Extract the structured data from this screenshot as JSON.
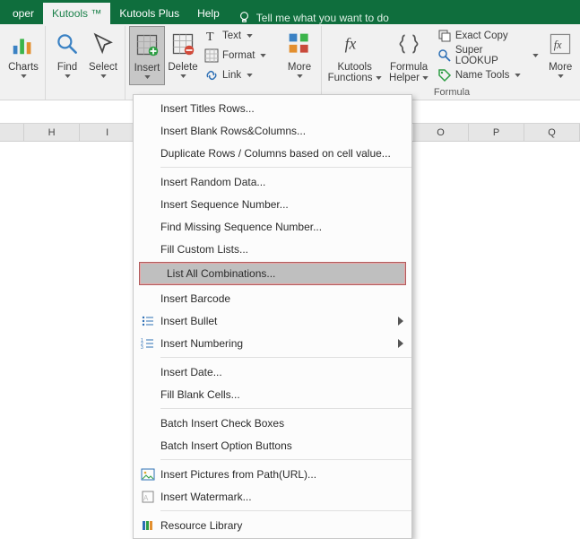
{
  "tabs": {
    "developer": "oper",
    "kutools": "Kutools ™",
    "kutools_plus": "Kutools Plus",
    "help": "Help",
    "tellme": "Tell me what you want to do"
  },
  "ribbon": {
    "charts": "Charts",
    "find": "Find",
    "select": "Select",
    "insert": "Insert",
    "delete": "Delete",
    "text": "Text",
    "format": "Format",
    "link": "Link",
    "more_1": "More",
    "kutools_functions_l1": "Kutools",
    "kutools_functions_l2": "Functions",
    "formula_helper_l1": "Formula",
    "formula_helper_l2": "Helper",
    "exact_copy": "Exact Copy",
    "super_lookup": "Super LOOKUP",
    "name_tools": "Name Tools",
    "more_2": "More",
    "group_formula": "Formula"
  },
  "columns": {
    "h": "H",
    "i": "I",
    "o": "O",
    "p": "P",
    "q": "Q"
  },
  "menu": {
    "titles_rows": "Insert Titles Rows...",
    "blank_rows": "Insert Blank Rows&Columns...",
    "duplicate_rows": "Duplicate Rows / Columns based on cell value...",
    "random_data": "Insert Random Data...",
    "sequence_number": "Insert Sequence Number...",
    "find_missing": "Find Missing Sequence Number...",
    "fill_lists": "Fill Custom Lists...",
    "list_comb": "List All Combinations...",
    "barcode": "Insert Barcode",
    "bullet": "Insert Bullet",
    "numbering": "Insert Numbering",
    "date": "Insert Date...",
    "fill_blank": "Fill Blank Cells...",
    "checkboxes": "Batch Insert Check Boxes",
    "option_btns": "Batch Insert Option Buttons",
    "pictures": "Insert Pictures from Path(URL)...",
    "watermark": "Insert Watermark...",
    "resource_lib": "Resource Library"
  }
}
